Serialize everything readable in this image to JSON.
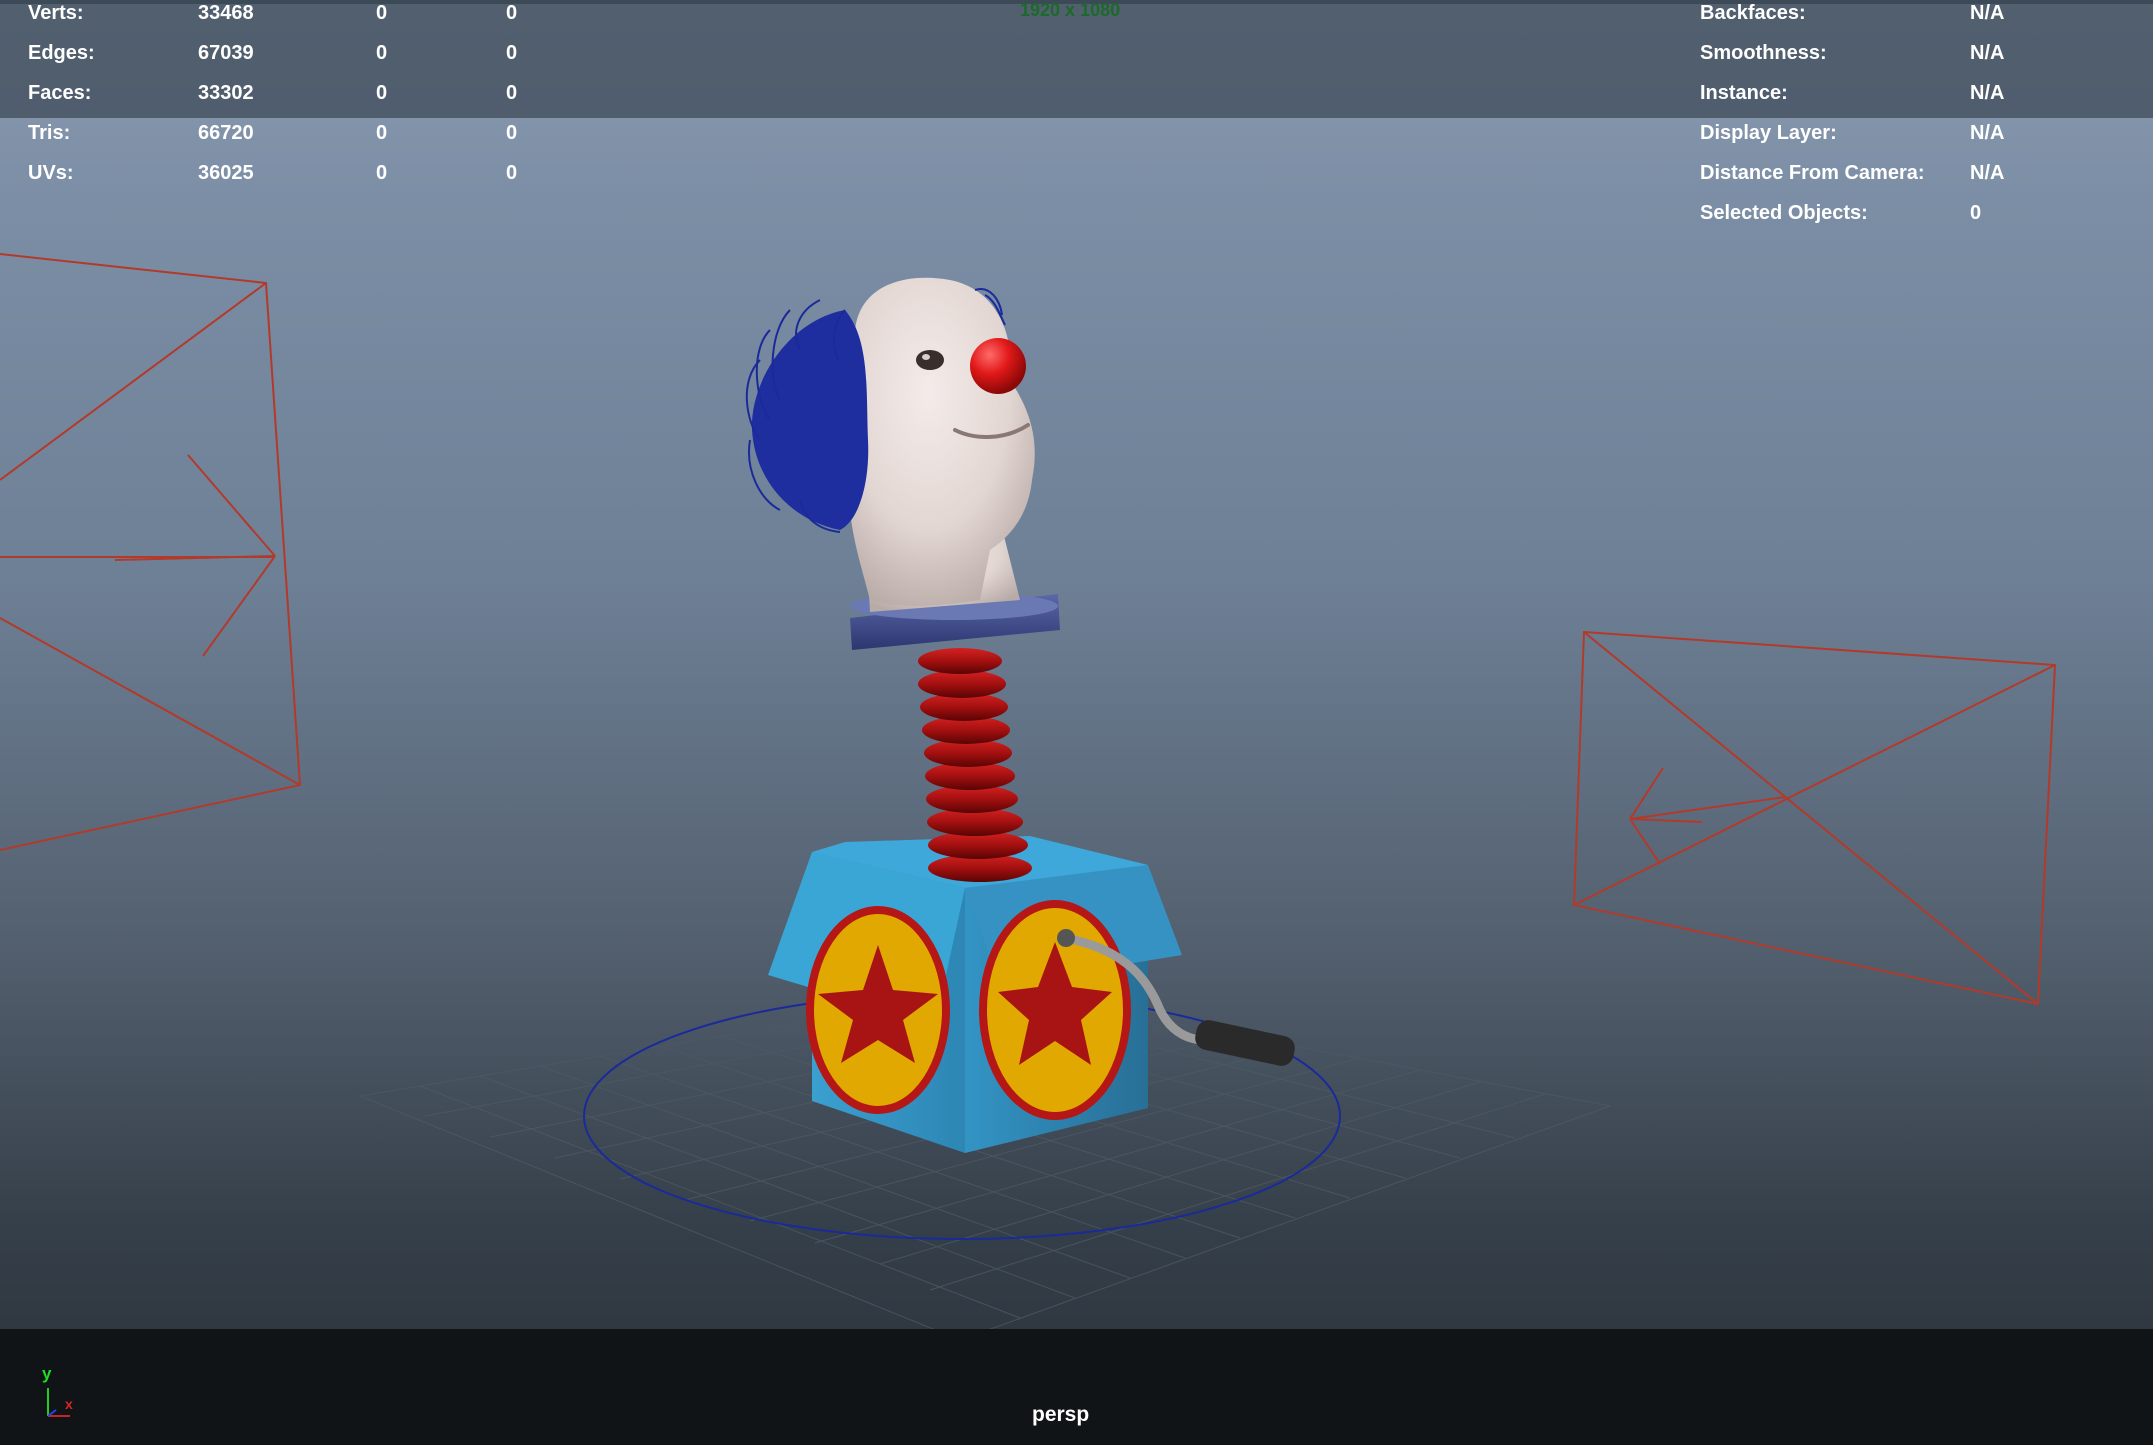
{
  "hud": {
    "left_rows": [
      {
        "label": "Verts:",
        "c1": "33468",
        "c2": "0",
        "c3": "0"
      },
      {
        "label": "Edges:",
        "c1": "67039",
        "c2": "0",
        "c3": "0"
      },
      {
        "label": "Faces:",
        "c1": "33302",
        "c2": "0",
        "c3": "0"
      },
      {
        "label": "Tris:",
        "c1": "66720",
        "c2": "0",
        "c3": "0"
      },
      {
        "label": "UVs:",
        "c1": "36025",
        "c2": "0",
        "c3": "0"
      }
    ],
    "right_rows": [
      {
        "label": "Backfaces:",
        "value": "N/A"
      },
      {
        "label": "Smoothness:",
        "value": "N/A"
      },
      {
        "label": "Instance:",
        "value": "N/A"
      },
      {
        "label": "Display Layer:",
        "value": "N/A"
      },
      {
        "label": "Distance From Camera:",
        "value": "N/A"
      },
      {
        "label": "Selected Objects:",
        "value": "0"
      }
    ],
    "resolution": "1920 x 1080"
  },
  "viewport": {
    "camera_name": "persp",
    "axis": {
      "y_label": "y",
      "x_label": "x"
    },
    "colors": {
      "camera_wireframe": "#b23a2a",
      "ground_circle": "#1a2a9a",
      "grid": "#4a5560",
      "box": "#2f8fbe",
      "badge": "#e0a800",
      "star": "#a81414",
      "spring": "#a41010",
      "nose": "#e01818",
      "hair": "#1a2a9a",
      "collar": "#3c4a8a",
      "skin": "#e6dcd8"
    }
  }
}
